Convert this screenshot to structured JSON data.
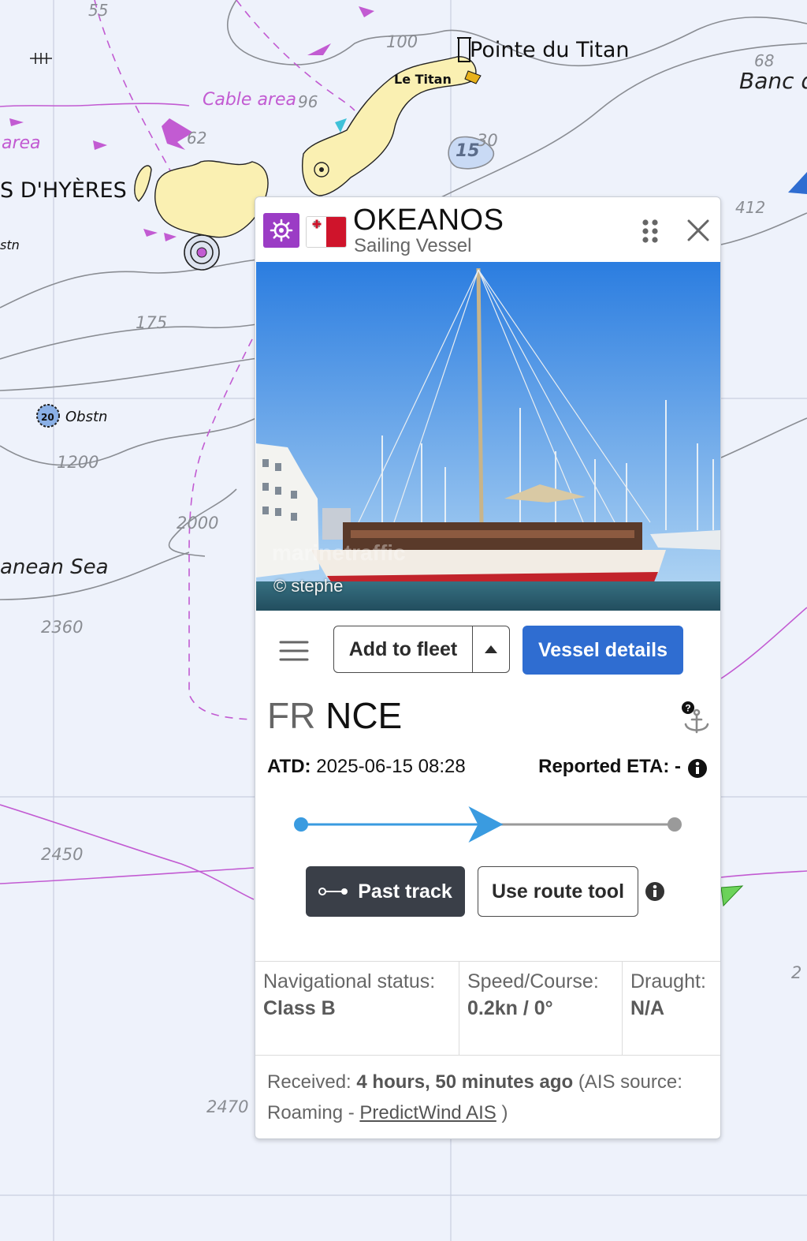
{
  "map": {
    "labels": {
      "pointe_du_titan": "Pointe du Titan",
      "le_titan": "Le Titan",
      "banc": "Banc d",
      "cable_area": "Cable area",
      "area": "area",
      "iles_hyeres": "S D'HYÈRES",
      "stn": "stn",
      "obstn": "Obstn",
      "obstn_depth": "20",
      "sea": "anean Sea"
    },
    "depths": [
      "55",
      "100",
      "68",
      "96",
      "62",
      "30",
      "15",
      "412",
      "175",
      "1200",
      "2000",
      "2360",
      "2450",
      "2470",
      "2"
    ]
  },
  "vessel": {
    "name": "OKEANOS",
    "type": "Sailing Vessel",
    "type_icon": "sailing-vessel-icon",
    "flag": "malta-flag",
    "photo_credit": "© stephe",
    "colors": {
      "type_icon_bg": "#9b3cc5",
      "primary_button": "#2f6dd1",
      "dark_button": "#3a3f48",
      "progress": "#3a9be0"
    }
  },
  "actions": {
    "add_to_fleet": "Add to fleet",
    "vessel_details": "Vessel details",
    "past_track": "Past track",
    "use_route_tool": "Use route tool"
  },
  "voyage": {
    "dep_country": "FR",
    "dep_port": "NCE",
    "atd_label": "ATD:",
    "atd_value": "2025-06-15 08:28",
    "eta_label": "Reported ETA:",
    "eta_value": "-",
    "progress_fraction": 0.52
  },
  "status": {
    "nav_label": "Navigational status:",
    "nav_value": "Class B",
    "speed_label": "Speed/Course:",
    "speed_value": "0.2kn / 0°",
    "draught_label": "Draught:",
    "draught_value": "N/A"
  },
  "received": {
    "prefix": "Received:",
    "age": "4 hours, 50 minutes ago",
    "source_prefix": "(AIS source: Roaming -",
    "source_link": "PredictWind AIS",
    "suffix": ")"
  }
}
